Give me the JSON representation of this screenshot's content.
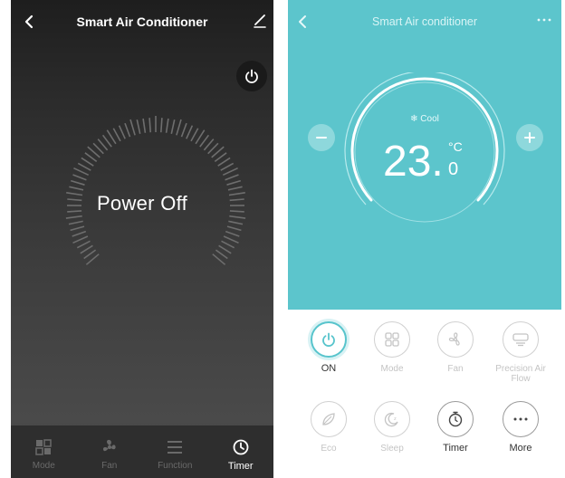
{
  "left_screen": {
    "header": {
      "title": "Smart Air Conditioner"
    },
    "status_text": "Power Off",
    "tabs": [
      {
        "label": "Mode",
        "icon": "mode-icon"
      },
      {
        "label": "Fan",
        "icon": "fan-icon"
      },
      {
        "label": "Function",
        "icon": "function-icon"
      },
      {
        "label": "Timer",
        "icon": "timer-icon",
        "active": true
      }
    ]
  },
  "right_screen": {
    "header": {
      "title": "Smart Air conditioner"
    },
    "mode": "Cool",
    "temperature": {
      "integer": "23.",
      "decimal": "0",
      "unit": "°C"
    },
    "controls": [
      {
        "label": "ON",
        "icon": "power-icon",
        "state": "active"
      },
      {
        "label": "Mode",
        "icon": "mode-icon",
        "state": "disabled"
      },
      {
        "label": "Fan",
        "icon": "fan-icon",
        "state": "disabled"
      },
      {
        "label": "Precision Air Flow",
        "icon": "air-flow-icon",
        "state": "disabled"
      },
      {
        "label": "Eco",
        "icon": "eco-leaf-icon",
        "state": "disabled"
      },
      {
        "label": "Sleep",
        "icon": "sleep-moon-icon",
        "state": "disabled"
      },
      {
        "label": "Timer",
        "icon": "stopwatch-icon",
        "state": "enabled"
      },
      {
        "label": "More",
        "icon": "more-dots-icon",
        "state": "enabled"
      }
    ]
  },
  "colors": {
    "teal": "#5cc5cc",
    "dark_bg": "#2a2a2a"
  }
}
